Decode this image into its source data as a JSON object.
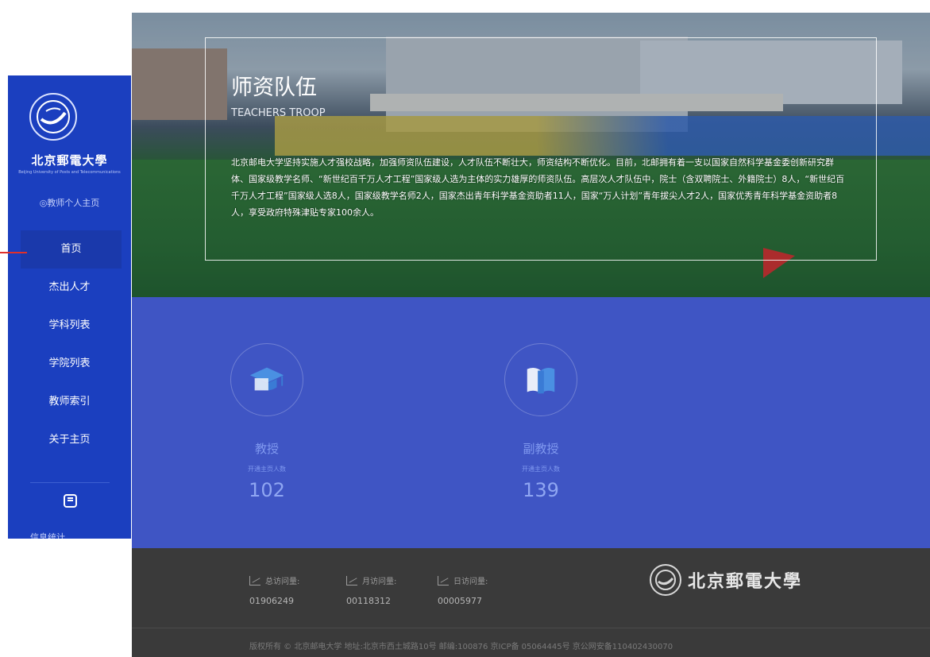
{
  "sidebar": {
    "university_name": "北京郵電大學",
    "university_subname": "Beijing University of Posts and Telecommunications",
    "personal_home": "◎教师个人主页",
    "menu": [
      {
        "label": "首页",
        "active": true
      },
      {
        "label": "杰出人才",
        "active": false
      },
      {
        "label": "学科列表",
        "active": false
      },
      {
        "label": "学院列表",
        "active": false
      },
      {
        "label": "教师索引",
        "active": false
      },
      {
        "label": "关于主页",
        "active": false
      }
    ],
    "bottom_label": "信息统计",
    "bg_color": "#1b3fbf"
  },
  "hero": {
    "title": "师资队伍",
    "subtitle": "TEACHERS TROOP",
    "description": "北京邮电大学坚持实施人才强校战略，加强师资队伍建设，人才队伍不断壮大，师资结构不断优化。目前，北邮拥有着一支以国家自然科学基金委创新研究群体、国家级教学名师、“新世纪百千万人才工程”国家级人选为主体的实力雄厚的师资队伍。高层次人才队伍中，院士（含双聘院士、外籍院士）8人，“新世纪百千万人才工程”国家级人选8人，国家级教学名师2人，国家杰出青年科学基金资助者11人，国家“万人计划”青年拔尖人才2人，国家优秀青年科学基金资助者8人，享受政府特殊津贴专家100余人。"
  },
  "stats": {
    "bg_color": "#3f55c4",
    "items": [
      {
        "icon": "graduation-cap-icon",
        "title": "教授",
        "label": "开通主页人数",
        "value": "102"
      },
      {
        "icon": "book-icon",
        "title": "副教授",
        "label": "开通主页人数",
        "value": "139"
      }
    ]
  },
  "footer": {
    "visits": [
      {
        "label": "总访问量:",
        "value": "01906249"
      },
      {
        "label": "月访问量:",
        "value": "00118312"
      },
      {
        "label": "日访问量:",
        "value": "00005977"
      }
    ],
    "logo_text": "北京郵電大學",
    "copyright": "版权所有 © 北京邮电大学  地址:北京市西土城路10号  邮编:100876  京ICP备 05064445号 京公网安备110402430070"
  }
}
